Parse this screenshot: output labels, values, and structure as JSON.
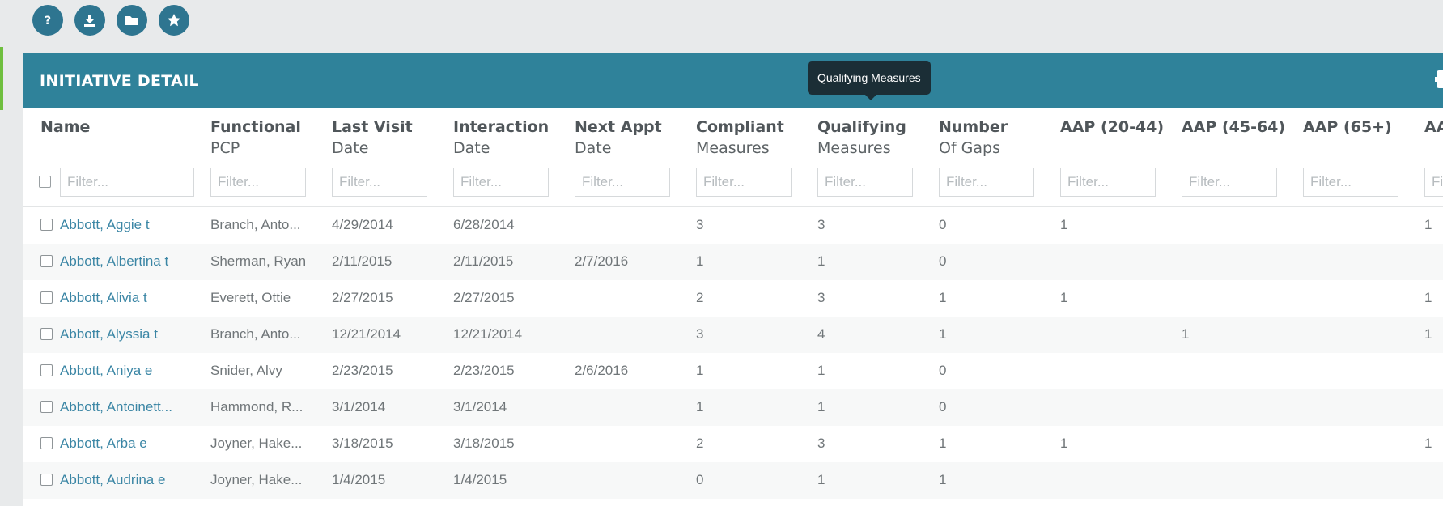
{
  "toolbar": {
    "help_icon": "question-icon",
    "download_icon": "download-icon",
    "folder_icon": "folder-icon",
    "favorite_icon": "star-icon"
  },
  "colors": {
    "header": "#2f829a",
    "link": "#3b86a5",
    "accent": "#6fbf3f",
    "tooltip": "#1b2e36"
  },
  "panel": {
    "title": "INITIATIVE DETAIL"
  },
  "tooltip": {
    "text": "Qualifying Measures"
  },
  "columns": [
    {
      "line1": "Name",
      "line2": ""
    },
    {
      "line1": "Functional",
      "line2": "PCP"
    },
    {
      "line1": "Last Visit",
      "line2": "Date"
    },
    {
      "line1": "Interaction",
      "line2": "Date"
    },
    {
      "line1": "Next Appt",
      "line2": "Date"
    },
    {
      "line1": "Compliant",
      "line2": "Measures"
    },
    {
      "line1": "Qualifying",
      "line2": "Measures"
    },
    {
      "line1": "Number",
      "line2": "Of Gaps"
    },
    {
      "line1": "AAP (20-44)",
      "line2": ""
    },
    {
      "line1": "AAP (45-64)",
      "line2": ""
    },
    {
      "line1": "AAP (65+)",
      "line2": ""
    },
    {
      "line1": "AA",
      "line2": ""
    }
  ],
  "filter_placeholder": "Filter...",
  "filter_placeholder_partial": "Fi",
  "rows": [
    [
      "Abbott, Aggie t",
      "Branch, Anto...",
      "4/29/2014",
      "6/28/2014",
      "",
      "3",
      "3",
      "0",
      "1",
      "",
      "",
      "1"
    ],
    [
      "Abbott, Albertina t",
      "Sherman, Ryan",
      "2/11/2015",
      "2/11/2015",
      "2/7/2016",
      "1",
      "1",
      "0",
      "",
      "",
      "",
      ""
    ],
    [
      "Abbott, Alivia t",
      "Everett, Ottie",
      "2/27/2015",
      "2/27/2015",
      "",
      "2",
      "3",
      "1",
      "1",
      "",
      "",
      "1"
    ],
    [
      "Abbott, Alyssia t",
      "Branch, Anto...",
      "12/21/2014",
      "12/21/2014",
      "",
      "3",
      "4",
      "1",
      "",
      "1",
      "",
      "1"
    ],
    [
      "Abbott, Aniya e",
      "Snider, Alvy",
      "2/23/2015",
      "2/23/2015",
      "2/6/2016",
      "1",
      "1",
      "0",
      "",
      "",
      "",
      ""
    ],
    [
      "Abbott, Antoinett...",
      "Hammond, R...",
      "3/1/2014",
      "3/1/2014",
      "",
      "1",
      "1",
      "0",
      "",
      "",
      "",
      ""
    ],
    [
      "Abbott, Arba e",
      "Joyner, Hake...",
      "3/18/2015",
      "3/18/2015",
      "",
      "2",
      "3",
      "1",
      "1",
      "",
      "",
      "1"
    ],
    [
      "Abbott, Audrina e",
      "Joyner, Hake...",
      "1/4/2015",
      "1/4/2015",
      "",
      "0",
      "1",
      "1",
      "",
      "",
      "",
      ""
    ]
  ]
}
